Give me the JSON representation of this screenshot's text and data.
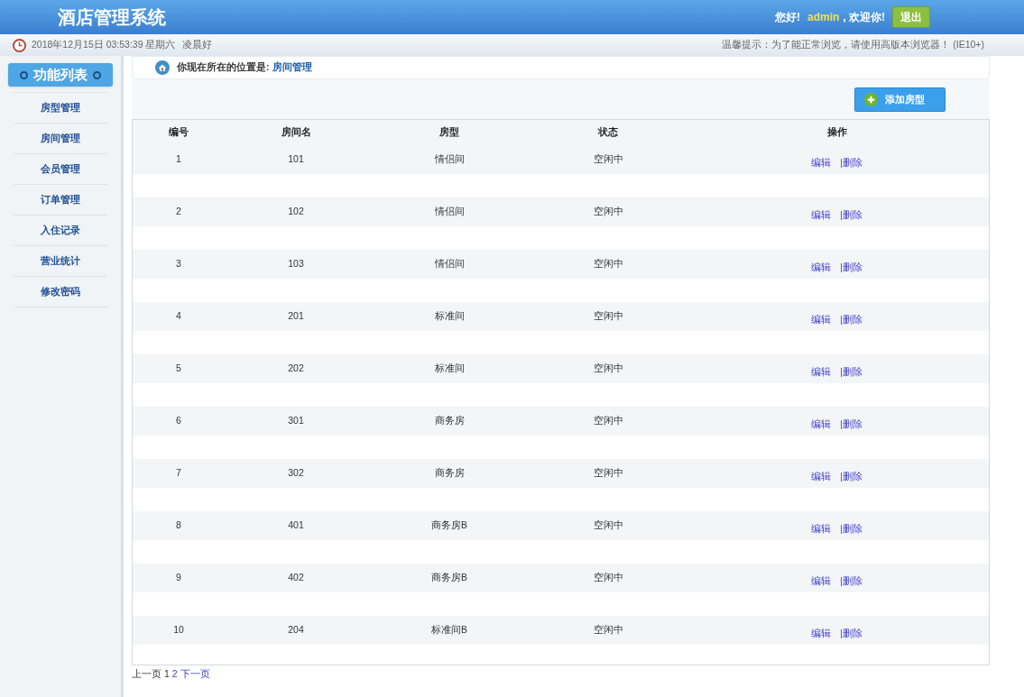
{
  "header": {
    "title": "酒店管理系统",
    "greeting": "您好!",
    "user": "admin",
    "welcome": ", 欢迎你!",
    "logout": "退出"
  },
  "info_bar": {
    "datetime": "2018年12月15日 03:53:39 星期六",
    "salutation": "凌晨好",
    "tip": "温馨提示：为了能正常浏览，请使用高版本浏览器！ (IE10+)"
  },
  "sidebar": {
    "title": "功能列表",
    "items": [
      {
        "label": "房型管理",
        "selected": false
      },
      {
        "label": "房间管理",
        "selected": false
      },
      {
        "label": "会员管理",
        "selected": false
      },
      {
        "label": "订单管理",
        "selected": false
      },
      {
        "label": "入住记录",
        "selected": false
      },
      {
        "label": "营业统计",
        "selected": false
      },
      {
        "label": "修改密码",
        "selected": false
      }
    ]
  },
  "breadcrumb": {
    "prefix": "你现在所在的位置是:",
    "current": "房间管理"
  },
  "add_button": "添加房型",
  "table": {
    "columns": [
      "编号",
      "房间名",
      "房型",
      "状态",
      "操作"
    ],
    "rows": [
      {
        "id": "1",
        "name": "101",
        "type": "情侣间",
        "status": "空闲中",
        "edit": "编辑",
        "delete": "|删除"
      },
      {
        "id": "2",
        "name": "102",
        "type": "情侣间",
        "status": "空闲中",
        "edit": "编辑",
        "delete": "|删除"
      },
      {
        "id": "3",
        "name": "103",
        "type": "情侣间",
        "status": "空闲中",
        "edit": "编辑",
        "delete": "|删除"
      },
      {
        "id": "4",
        "name": "201",
        "type": "标准间",
        "status": "空闲中",
        "edit": "编辑",
        "delete": "|删除"
      },
      {
        "id": "5",
        "name": "202",
        "type": "标准间",
        "status": "空闲中",
        "edit": "编辑",
        "delete": "|删除"
      },
      {
        "id": "6",
        "name": "301",
        "type": "商务房",
        "status": "空闲中",
        "edit": "编辑",
        "delete": "|删除"
      },
      {
        "id": "7",
        "name": "302",
        "type": "商务房",
        "status": "空闲中",
        "edit": "编辑",
        "delete": "|删除"
      },
      {
        "id": "8",
        "name": "401",
        "type": "商务房B",
        "status": "空闲中",
        "edit": "编辑",
        "delete": "|删除"
      },
      {
        "id": "9",
        "name": "402",
        "type": "商务房B",
        "status": "空闲中",
        "edit": "编辑",
        "delete": "|删除"
      },
      {
        "id": "10",
        "name": "204",
        "type": "标准间B",
        "status": "空闲中",
        "edit": "编辑",
        "delete": "|删除"
      }
    ]
  },
  "pagination": [
    {
      "label": "上一页",
      "link": false
    },
    {
      "label": "1",
      "link": false
    },
    {
      "label": "2",
      "link": true
    },
    {
      "label": "下一页",
      "link": true
    }
  ]
}
